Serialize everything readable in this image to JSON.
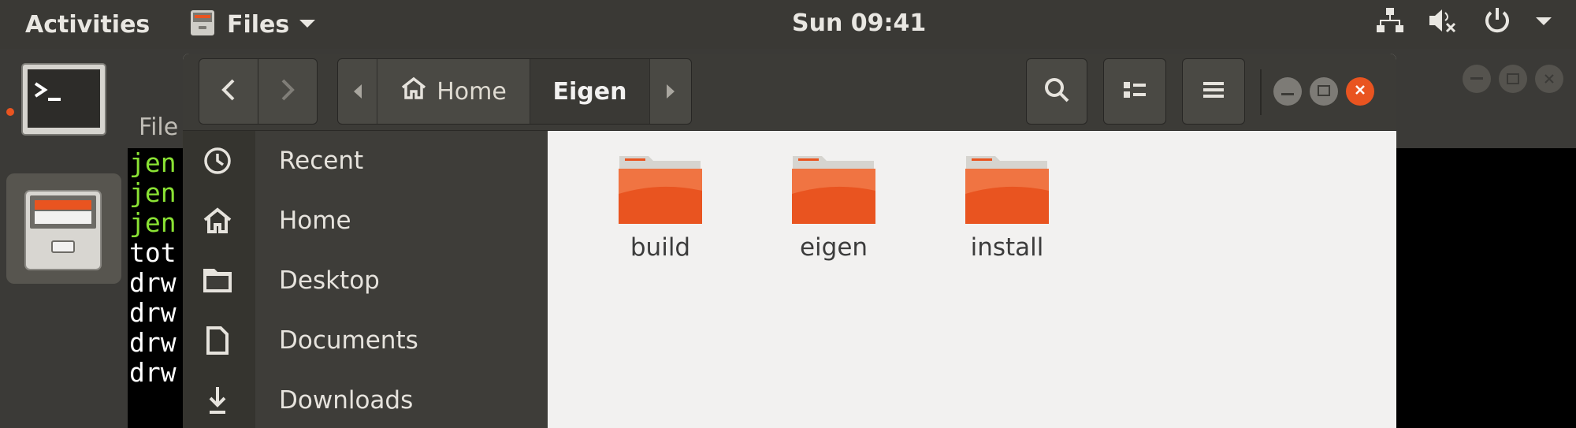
{
  "topbar": {
    "activities": "Activities",
    "app_name": "Files",
    "clock": "Sun 09:41"
  },
  "terminal": {
    "title": "File",
    "lines": [
      {
        "text": "jen",
        "color": "green"
      },
      {
        "text": "jen",
        "color": "green"
      },
      {
        "text": "jen",
        "color": "green"
      },
      {
        "text": "tot",
        "color": "white"
      },
      {
        "text": "drw",
        "color": "white"
      },
      {
        "text": "drw",
        "color": "white"
      },
      {
        "text": "drw",
        "color": "white"
      },
      {
        "text": "drw",
        "color": "white"
      }
    ]
  },
  "files_window": {
    "path": {
      "segments": [
        "Home",
        "Eigen"
      ]
    },
    "sidebar": {
      "items": [
        {
          "label": "Recent",
          "icon": "clock-icon"
        },
        {
          "label": "Home",
          "icon": "home-icon"
        },
        {
          "label": "Desktop",
          "icon": "folder-icon"
        },
        {
          "label": "Documents",
          "icon": "document-icon"
        },
        {
          "label": "Downloads",
          "icon": "download-icon"
        }
      ]
    },
    "folders": [
      {
        "name": "build"
      },
      {
        "name": "eigen"
      },
      {
        "name": "install"
      }
    ]
  },
  "colors": {
    "accent": "#e95420",
    "headerbar": "#3c3b37",
    "sidebar": "#3e3d39",
    "content": "#f2f1f0"
  }
}
